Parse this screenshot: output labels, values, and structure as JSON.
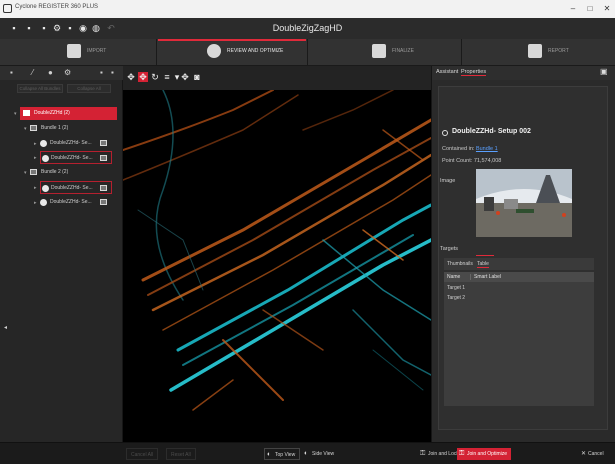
{
  "window": {
    "title": "Cyclone REGISTER 360 PLUS",
    "controls": [
      "–",
      "□",
      "✕"
    ]
  },
  "toolbar": {
    "document_title": "DoubleZigZagHD"
  },
  "workflow": {
    "steps": [
      {
        "label": "IMPORT"
      },
      {
        "label": "REVIEW AND OPTIMIZE"
      },
      {
        "label": "FINALIZE"
      },
      {
        "label": "REPORT"
      }
    ],
    "active_index": 1
  },
  "left_panel": {
    "collapse_left": "Collapse All Bundles",
    "collapse_right": "Collapse All",
    "tree": {
      "root": "DoubleZZHd (2)",
      "bundle1": "Bundle 1 (2)",
      "bundle1_items": [
        "DoubleZZHd- Se...",
        "DoubleZZHd- Se..."
      ],
      "bundle2": "Bundle 2 (2)",
      "bundle2_items": [
        "DoubleZZHd- Se...",
        "DoubleZZHd- Se..."
      ]
    }
  },
  "right_panel": {
    "tabs": [
      "Assistant",
      "Properties"
    ],
    "active_tab": 1,
    "heading": "DoubleZZHd- Setup 002",
    "contained_in_label": "Contained in:",
    "contained_in_value": "Bundle 1",
    "point_count_label": "Point Count:",
    "point_count_value": "71,574,008",
    "image_label": "Image",
    "targets_label": "Targets",
    "target_tabs": [
      "Thumbnails",
      "Table"
    ],
    "target_columns": [
      "Name",
      "Smart Label"
    ],
    "targets": [
      "Target 1",
      "Target 2"
    ]
  },
  "bottom_bar": {
    "left_buttons": [
      "Cancel All",
      "Reset All"
    ],
    "top_view": "Top View",
    "side_view": "Side View",
    "join_lock": "Join and Lock",
    "join_optimize": "Join and Optimize",
    "cancel": "Cancel"
  }
}
